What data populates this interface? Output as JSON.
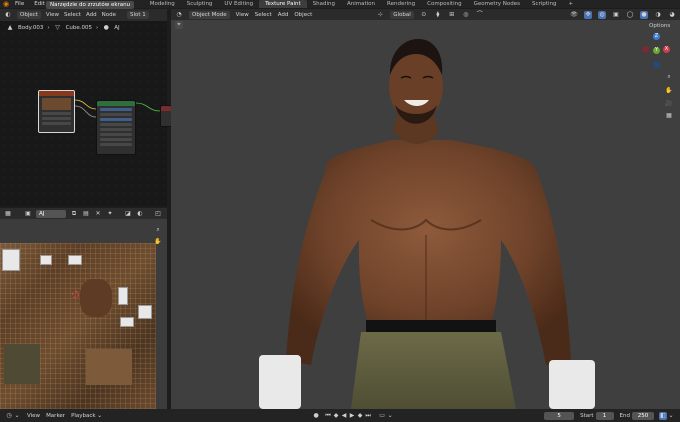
{
  "menubar": {
    "app_icon": "blender-logo-icon",
    "menus": [
      "File",
      "Edit",
      "R"
    ],
    "tooltip": "Narzędzie do zrzutów ekranu",
    "tabs": [
      "Modeling",
      "Sculpting",
      "UV Editing",
      "Texture Paint",
      "Shading",
      "Animation",
      "Rendering",
      "Compositing",
      "Geometry Nodes",
      "Scripting"
    ],
    "active_tab": "Texture Paint",
    "add_tab": "+"
  },
  "node_editor": {
    "header": {
      "mode": "Object",
      "menus": [
        "View",
        "Select",
        "Add",
        "Node"
      ],
      "slot": "Slot 1"
    },
    "breadcrumb": [
      "Body.003",
      "Cube.005",
      "AJ"
    ]
  },
  "uv_editor": {
    "header": {
      "image_name": "AJ"
    }
  },
  "viewport": {
    "header": {
      "mode": "Object Mode",
      "menus": [
        "View",
        "Select",
        "Add",
        "Object"
      ],
      "orientation": "Global"
    },
    "options_label": "Options",
    "gizmo": {
      "x": "X",
      "y": "Y",
      "z": "Z"
    }
  },
  "timeline": {
    "menus": [
      "View",
      "Marker",
      "Playback"
    ],
    "current_frame": "5",
    "start_label": "Start",
    "start_value": "1",
    "end_label": "End",
    "end_value": "250"
  }
}
